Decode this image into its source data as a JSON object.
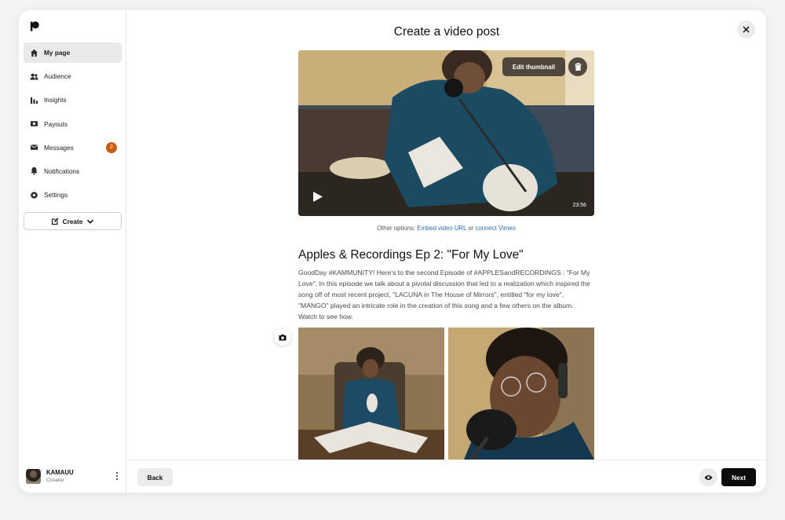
{
  "sidebar": {
    "items": [
      {
        "label": "My page",
        "icon": "home-icon",
        "active": true
      },
      {
        "label": "Audience",
        "icon": "people-icon"
      },
      {
        "label": "Insights",
        "icon": "bar-chart-icon"
      },
      {
        "label": "Payouts",
        "icon": "money-icon"
      },
      {
        "label": "Messages",
        "icon": "mail-icon",
        "badge": "2"
      },
      {
        "label": "Notifications",
        "icon": "bell-icon"
      },
      {
        "label": "Settings",
        "icon": "gear-icon"
      }
    ],
    "create_label": "Create",
    "profile": {
      "name": "KAMAUU",
      "role": "Creator"
    }
  },
  "main": {
    "title": "Create a video post",
    "video": {
      "edit_thumbnail_label": "Edit thumbnail",
      "duration": "23:56"
    },
    "other_options": {
      "prefix": "Other options:",
      "embed_label": "Embed video URL",
      "or": "or",
      "vimeo_label": "connect Vimeo"
    },
    "post": {
      "title": "Apples & Recordings Ep 2: \"For My Love\"",
      "body": "GoodDay #KAMMUNITY! Here's to the second Episode of #APPLESandRECORDINGS : \"For My Love\". In this episode we talk about a pivotal discussion that led to a realization which inspired the song off of most recent project, \"LACUNA in The House of Mirrors\", entitled \"for my love\", \"MANGO\" played an intricate role in the creation of this song and a few others on the album. Watch to see how."
    }
  },
  "footer": {
    "back_label": "Back",
    "next_label": "Next"
  },
  "colors": {
    "badge": "#c95b12",
    "link": "#2a6fb0",
    "primary_button": "#0b0b0b"
  }
}
